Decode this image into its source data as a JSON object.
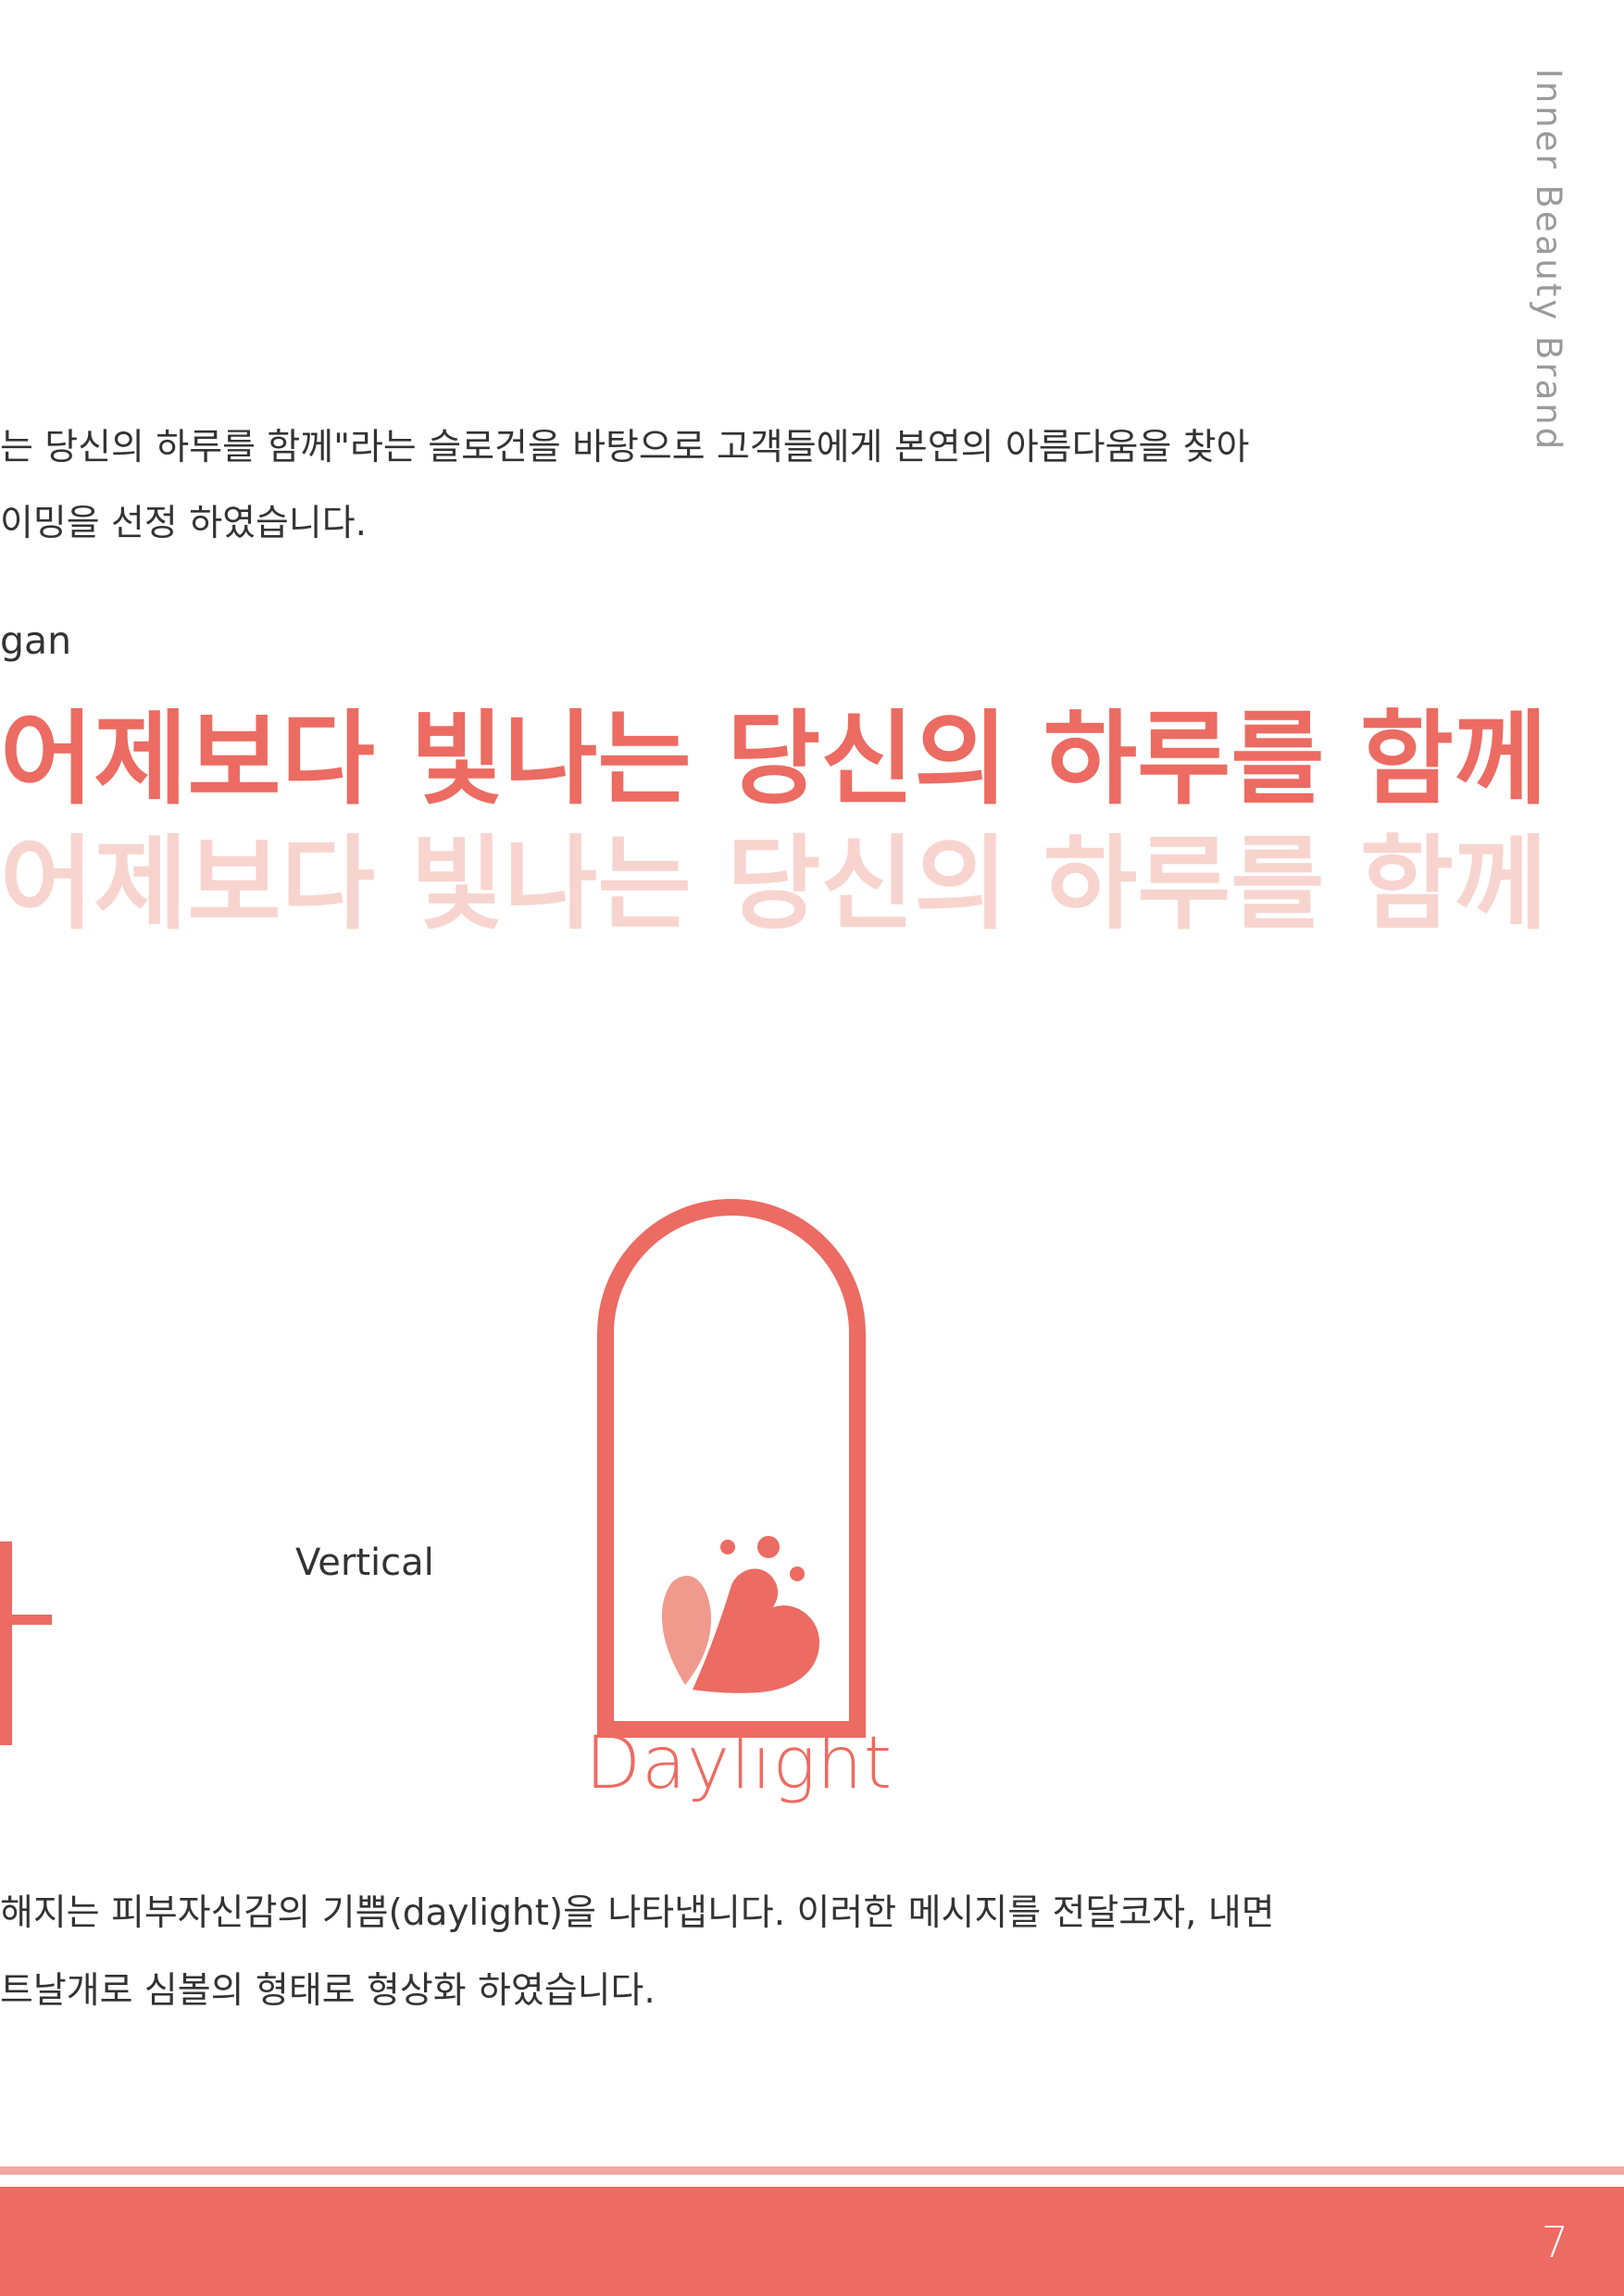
{
  "side": {
    "brand_tagline": "Inner Beauty Brand"
  },
  "intro": {
    "lines": [
      "는 당신의 하루를 함께\"라는 슬로건을 바탕으로 고객들에게 본연의 아름다움을 찾아",
      "이밍을 선정 하였습니다."
    ]
  },
  "slogan": {
    "label": "gan",
    "main": "어제보다 빛나는 당신의 하루를 함께",
    "ghost": "어제보다 빛나는 당신의 하루를 함께"
  },
  "logo": {
    "vertical_label": "Vertical",
    "wordmark": "Daylight",
    "partial_glyph": "t"
  },
  "description": {
    "lines": [
      "해지는 피부자신감의 기쁨(daylight)을 나타냅니다. 이러한 메시지를 전달코자, 내면",
      "트날개로 심볼의 형태로 형상화 하였습니다."
    ]
  },
  "footer": {
    "page_number": "7"
  },
  "colors": {
    "accent": "#ec6b62",
    "accent_light": "#f8d4cf",
    "wing_light": "#f09a8d",
    "footer_line": "#f2a89f",
    "text": "#333333",
    "muted": "#9a9a9a"
  }
}
